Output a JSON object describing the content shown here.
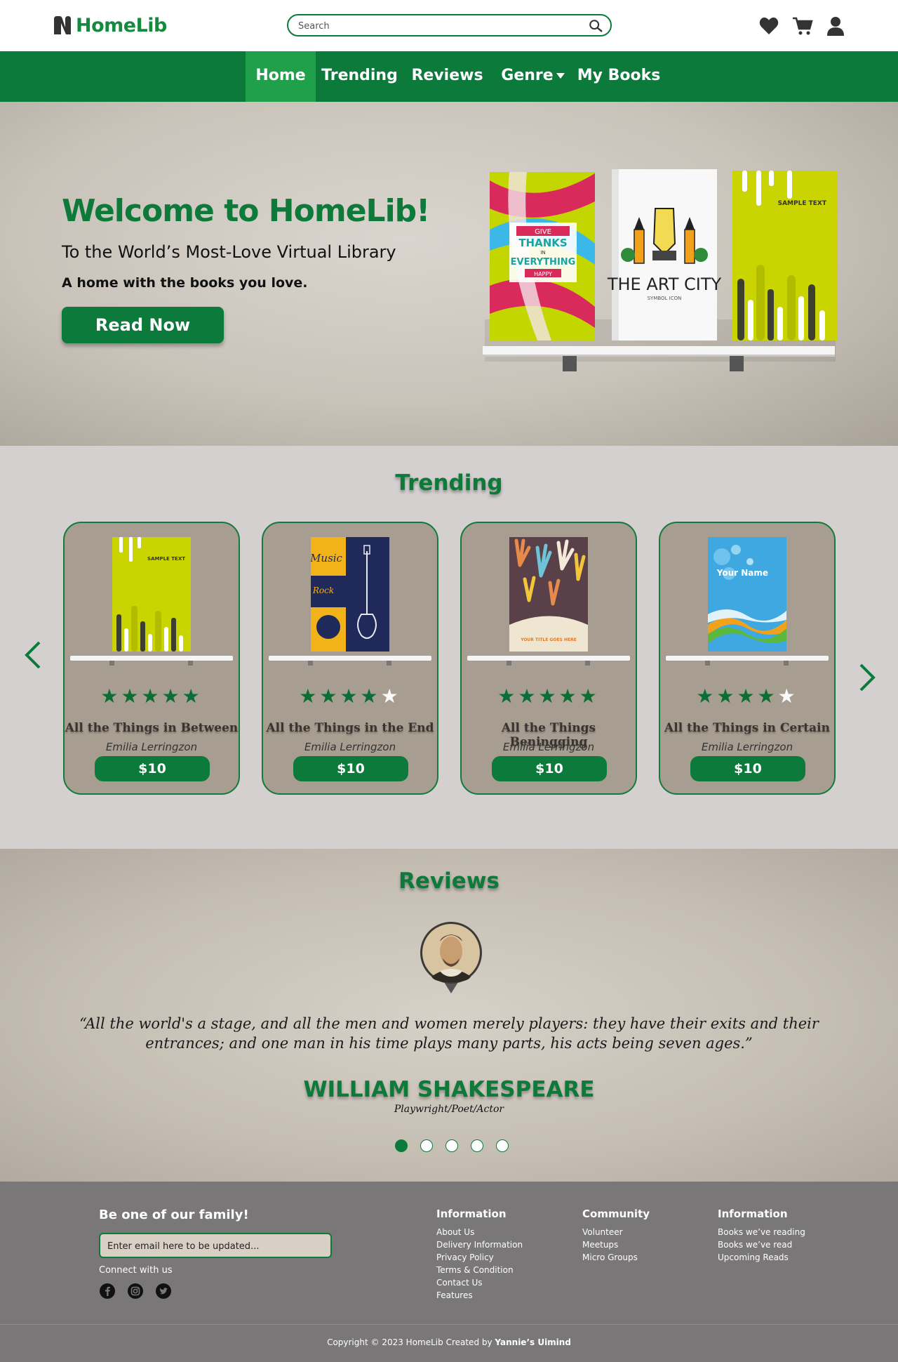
{
  "brand": {
    "name": "HomeLib"
  },
  "search": {
    "placeholder": "Search"
  },
  "nav": {
    "items": [
      {
        "label": "Home",
        "active": true
      },
      {
        "label": "Trending"
      },
      {
        "label": "Reviews"
      },
      {
        "label": "Genre"
      },
      {
        "label": "My Books"
      }
    ]
  },
  "hero": {
    "title": "Welcome to HomeLib!",
    "subtitle": "To the World’s Most-Love Virtual Library",
    "tagline": "A home with the books you love.",
    "cta": "Read Now",
    "books": [
      {
        "cover_text": [
          "GIVE",
          "THANKS",
          "IN",
          "EVERYTHING",
          "HAPPY"
        ]
      },
      {
        "cover_text": [
          "THE ART CITY",
          "SYMBOL ICON"
        ]
      },
      {
        "cover_text": [
          "SAMPLE TEXT"
        ]
      }
    ]
  },
  "trending": {
    "title": "Trending",
    "books": [
      {
        "title": "All the Things in Between",
        "author": "Emilia Lerringzon",
        "price": "$10",
        "rating": 5,
        "cover_text": "SAMPLE TEXT"
      },
      {
        "title": "All the Things in the End",
        "author": "Emilia Lerringzon",
        "price": "$10",
        "rating": 4,
        "cover_text": "Music"
      },
      {
        "title": "All the Things Beningging",
        "author": "Emilia Lerringzon",
        "price": "$10",
        "rating": 5,
        "cover_text": "YOUR TITLE GOES HERE"
      },
      {
        "title": "All the Things in Certain",
        "author": "Emilia Lerringzon",
        "price": "$10",
        "rating": 4,
        "cover_text": "Your Name"
      }
    ]
  },
  "reviews": {
    "title": "Reviews",
    "quote": "“All the world's a stage, and all the men and women merely players: they have their exits and their entrances; and one man in his time plays many parts, his acts being seven ages.”",
    "name": "WILLIAM SHAKESPEARE",
    "role": "Playwright/Poet/Actor",
    "active_slide": 1,
    "total_slides": 5
  },
  "footer": {
    "newsletter_title": "Be one of our family!",
    "email_placeholder": "Enter email here to be updated...",
    "connect_label": "Connect with us",
    "socials": [
      "facebook-icon",
      "instagram-icon",
      "twitter-icon"
    ],
    "columns": [
      {
        "title": "Information",
        "links": [
          "About Us",
          "Delivery Information",
          "Privacy Policy",
          "Terms & Condition",
          "Contact Us",
          "Features"
        ]
      },
      {
        "title": "Community",
        "links": [
          "Volunteer",
          "Meetups",
          "Micro Groups"
        ]
      },
      {
        "title": "Information",
        "links": [
          "Books we’ve reading",
          "Books we’ve read",
          "Upcoming Reads"
        ]
      }
    ],
    "copyright": "Copyright © 2023 HomeLib Created by",
    "copyright_author": "Yannie’s Uimind"
  },
  "colors": {
    "primary": "#0b7a3b",
    "accent": "#20a04b",
    "card": "#a79e91",
    "footer": "#797777"
  }
}
